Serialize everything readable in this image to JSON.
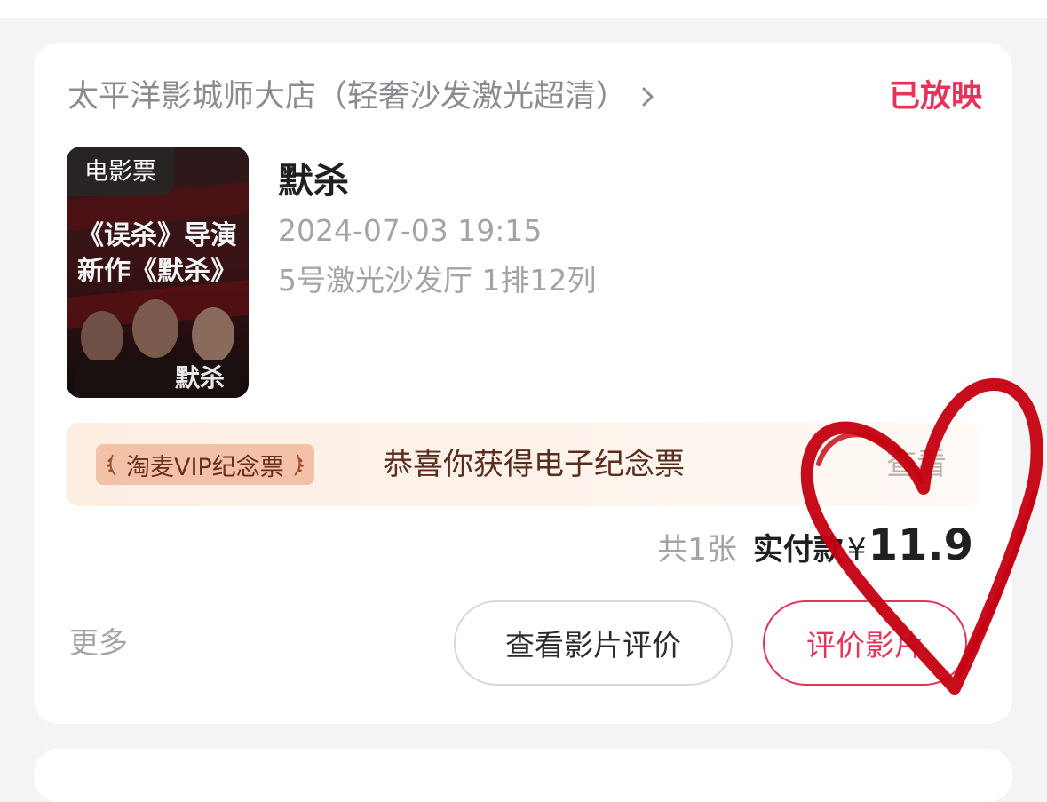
{
  "order": {
    "cinema_name": "太平洋影城师大店（轻奢沙发激光超清）",
    "status": "已放映",
    "poster_tag": "电影票",
    "movie_title": "默杀",
    "showtime": "2024-07-03 19:15",
    "seat_info": "5号激光沙发厅 1排12列",
    "ticket_count": "共1张",
    "paid_label": "实付款",
    "currency_symbol": "¥",
    "amount": "11.9"
  },
  "vip_banner": {
    "badge_label": "淘麦VIP纪念票",
    "message": "恭喜你获得电子纪念票",
    "view_link": "查看"
  },
  "actions": {
    "more_label": "更多",
    "view_reviews_label": "查看影片评价",
    "rate_movie_label": "评价影片"
  },
  "poster_art": {
    "line1": "《误杀》导演",
    "line2": "新作《默杀》",
    "logo_text": "默杀"
  },
  "colors": {
    "accent": "#e5335a",
    "heart_doodle": "#c4000f",
    "vip_badge_bg": "#f2c1a7",
    "banner_bg": "#fdeee2"
  },
  "icons": {
    "cinema_link": "chevron-right-icon",
    "vip_badge_left": "laurel-left-icon",
    "vip_badge_right": "laurel-right-icon"
  }
}
